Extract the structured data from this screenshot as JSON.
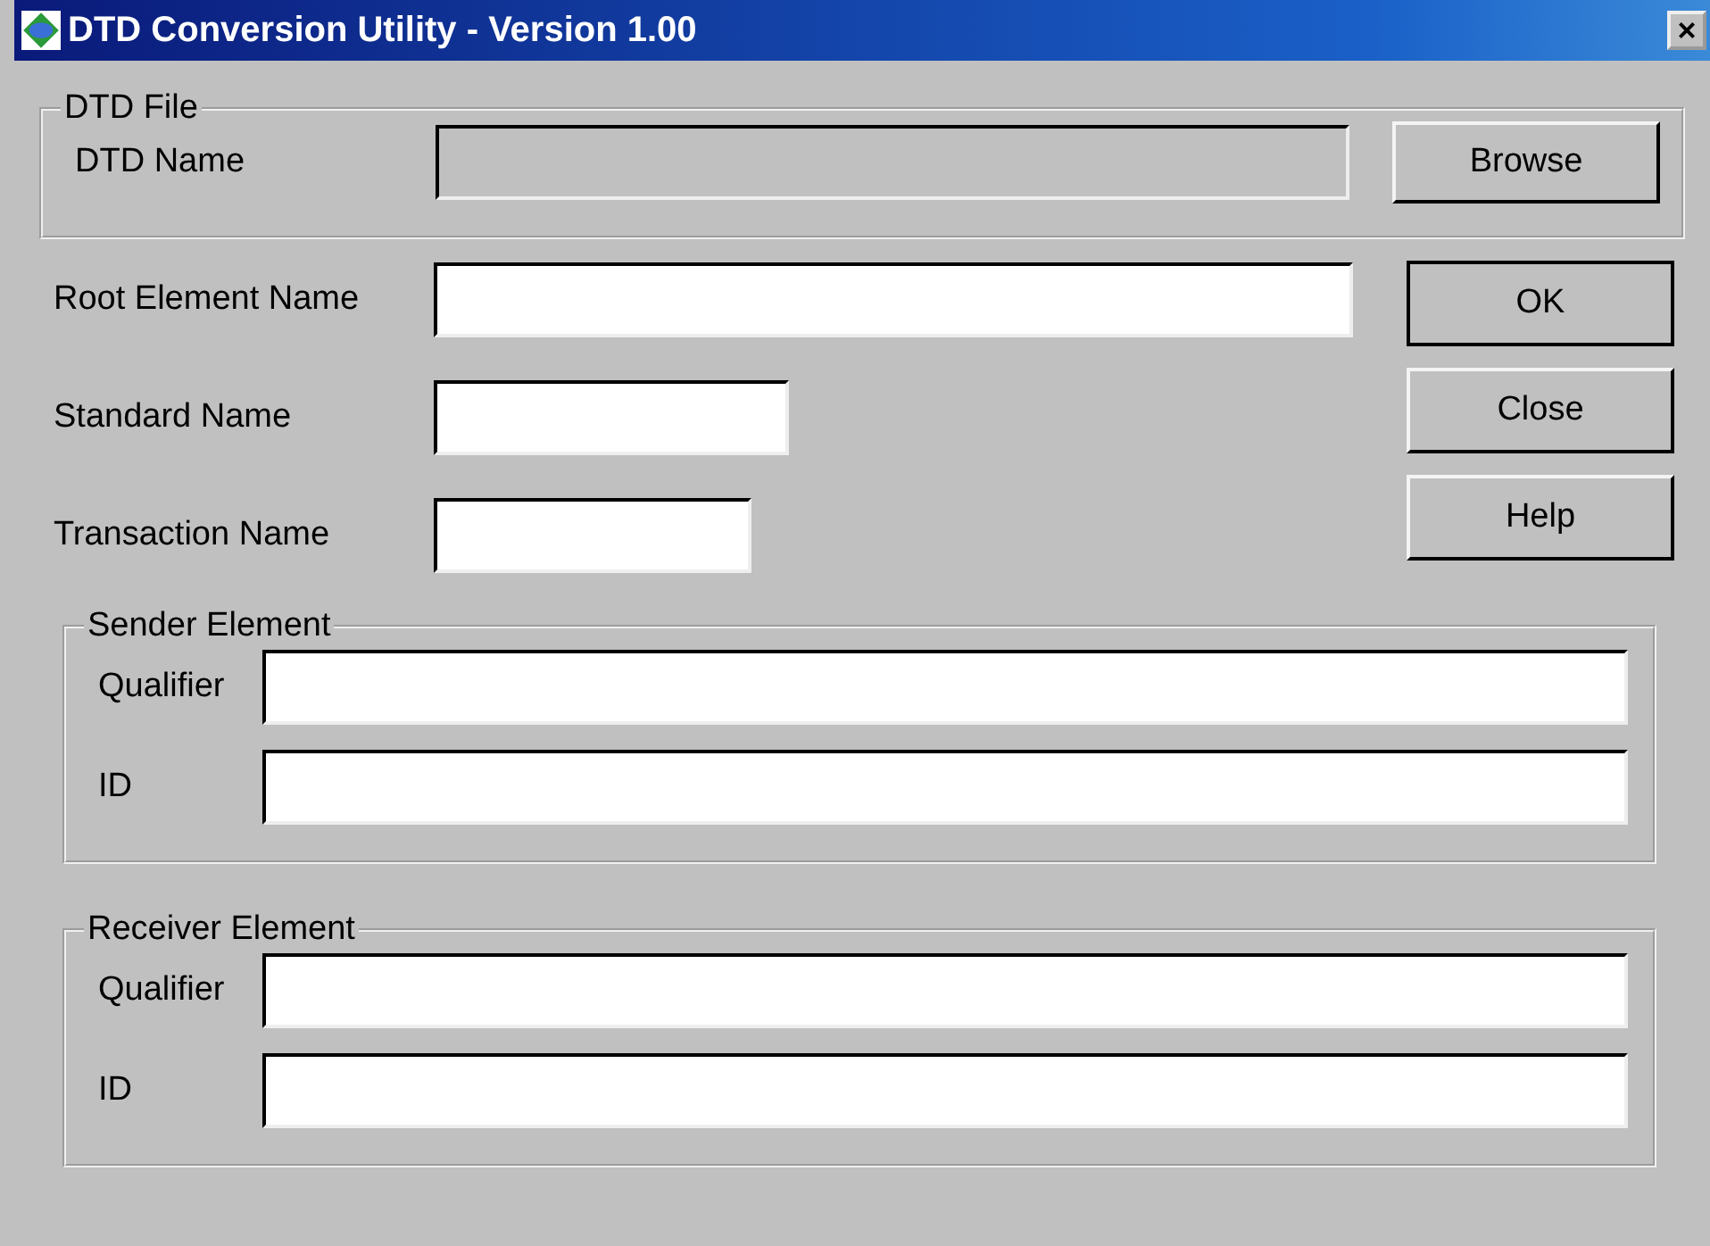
{
  "window": {
    "title": "DTD Conversion Utility - Version 1.00",
    "close": "×"
  },
  "dtd_file": {
    "legend": "DTD File",
    "label": "DTD Name",
    "field": {
      "disabled": true
    },
    "button": "Browse"
  },
  "fields": [
    {
      "label": "Root Element Name"
    },
    {
      "label": "Standard Name"
    },
    {
      "label": "Transaction Name"
    }
  ],
  "buttons": [
    {
      "label": "OK",
      "default": true
    },
    {
      "label": "Close",
      "default": false
    },
    {
      "label": "Help",
      "default": false
    }
  ],
  "groups": [
    {
      "legend": "Sender Element",
      "rows": [
        {
          "label": "Qualifier"
        },
        {
          "label": "ID"
        }
      ]
    },
    {
      "legend": "Receiver Element",
      "rows": [
        {
          "label": "Qualifier"
        },
        {
          "label": "ID"
        }
      ]
    }
  ]
}
